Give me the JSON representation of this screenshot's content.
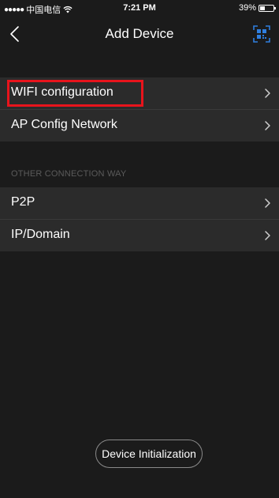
{
  "status_bar": {
    "signal": "●●●●●",
    "carrier": "中国电信",
    "time": "7:21 PM",
    "battery_percent": "39%",
    "battery_level": 0.39
  },
  "nav": {
    "title": "Add Device",
    "back_icon": "chevron-left-icon",
    "scan_icon": "qr-scan-icon"
  },
  "list": {
    "group1": [
      {
        "label": "WIFI configuration",
        "highlighted": true
      },
      {
        "label": "AP Config Network",
        "highlighted": false
      }
    ],
    "section_header": "OTHER CONNECTION WAY",
    "group2": [
      {
        "label": "P2P"
      },
      {
        "label": "IP/Domain"
      }
    ]
  },
  "footer": {
    "init_button_label": "Device Initialization"
  },
  "colors": {
    "background": "#1b1b1b",
    "cell": "#2b2b2b",
    "highlight": "#e8141c",
    "scan_icon": "#2f7fe0"
  }
}
